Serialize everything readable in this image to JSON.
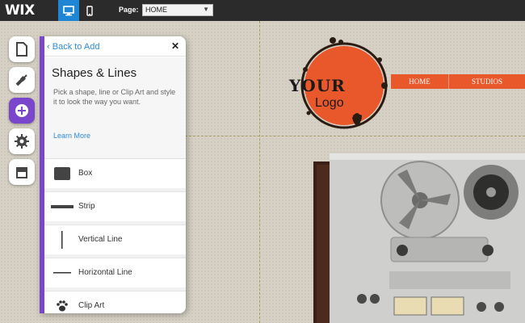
{
  "topbar": {
    "brand": "WIX",
    "page_label": "Page:",
    "page_value": "HOME",
    "accent_color": "#1f86d6"
  },
  "site": {
    "logo_line1": "YOUR",
    "logo_line2": "Logo",
    "nav": [
      "HOME",
      "STUDIOS"
    ],
    "brand_color": "#e8582b"
  },
  "rail": {
    "items": [
      "pages-icon",
      "design-icon",
      "add-icon",
      "settings-icon",
      "app-market-icon"
    ],
    "active": "add-icon",
    "active_color": "#7a46cc"
  },
  "panel": {
    "back_label": "Back to Add",
    "title": "Shapes & Lines",
    "description": "Pick a shape, line or Clip Art and style it to look the way you want.",
    "learn_more": "Learn More",
    "items": [
      {
        "label": "Box",
        "icon": "box-icon"
      },
      {
        "label": "Strip",
        "icon": "strip-icon"
      },
      {
        "label": "Vertical Line",
        "icon": "vertical-line-icon"
      },
      {
        "label": "Horizontal Line",
        "icon": "horizontal-line-icon"
      },
      {
        "label": "Clip Art",
        "icon": "paw-icon"
      }
    ]
  }
}
